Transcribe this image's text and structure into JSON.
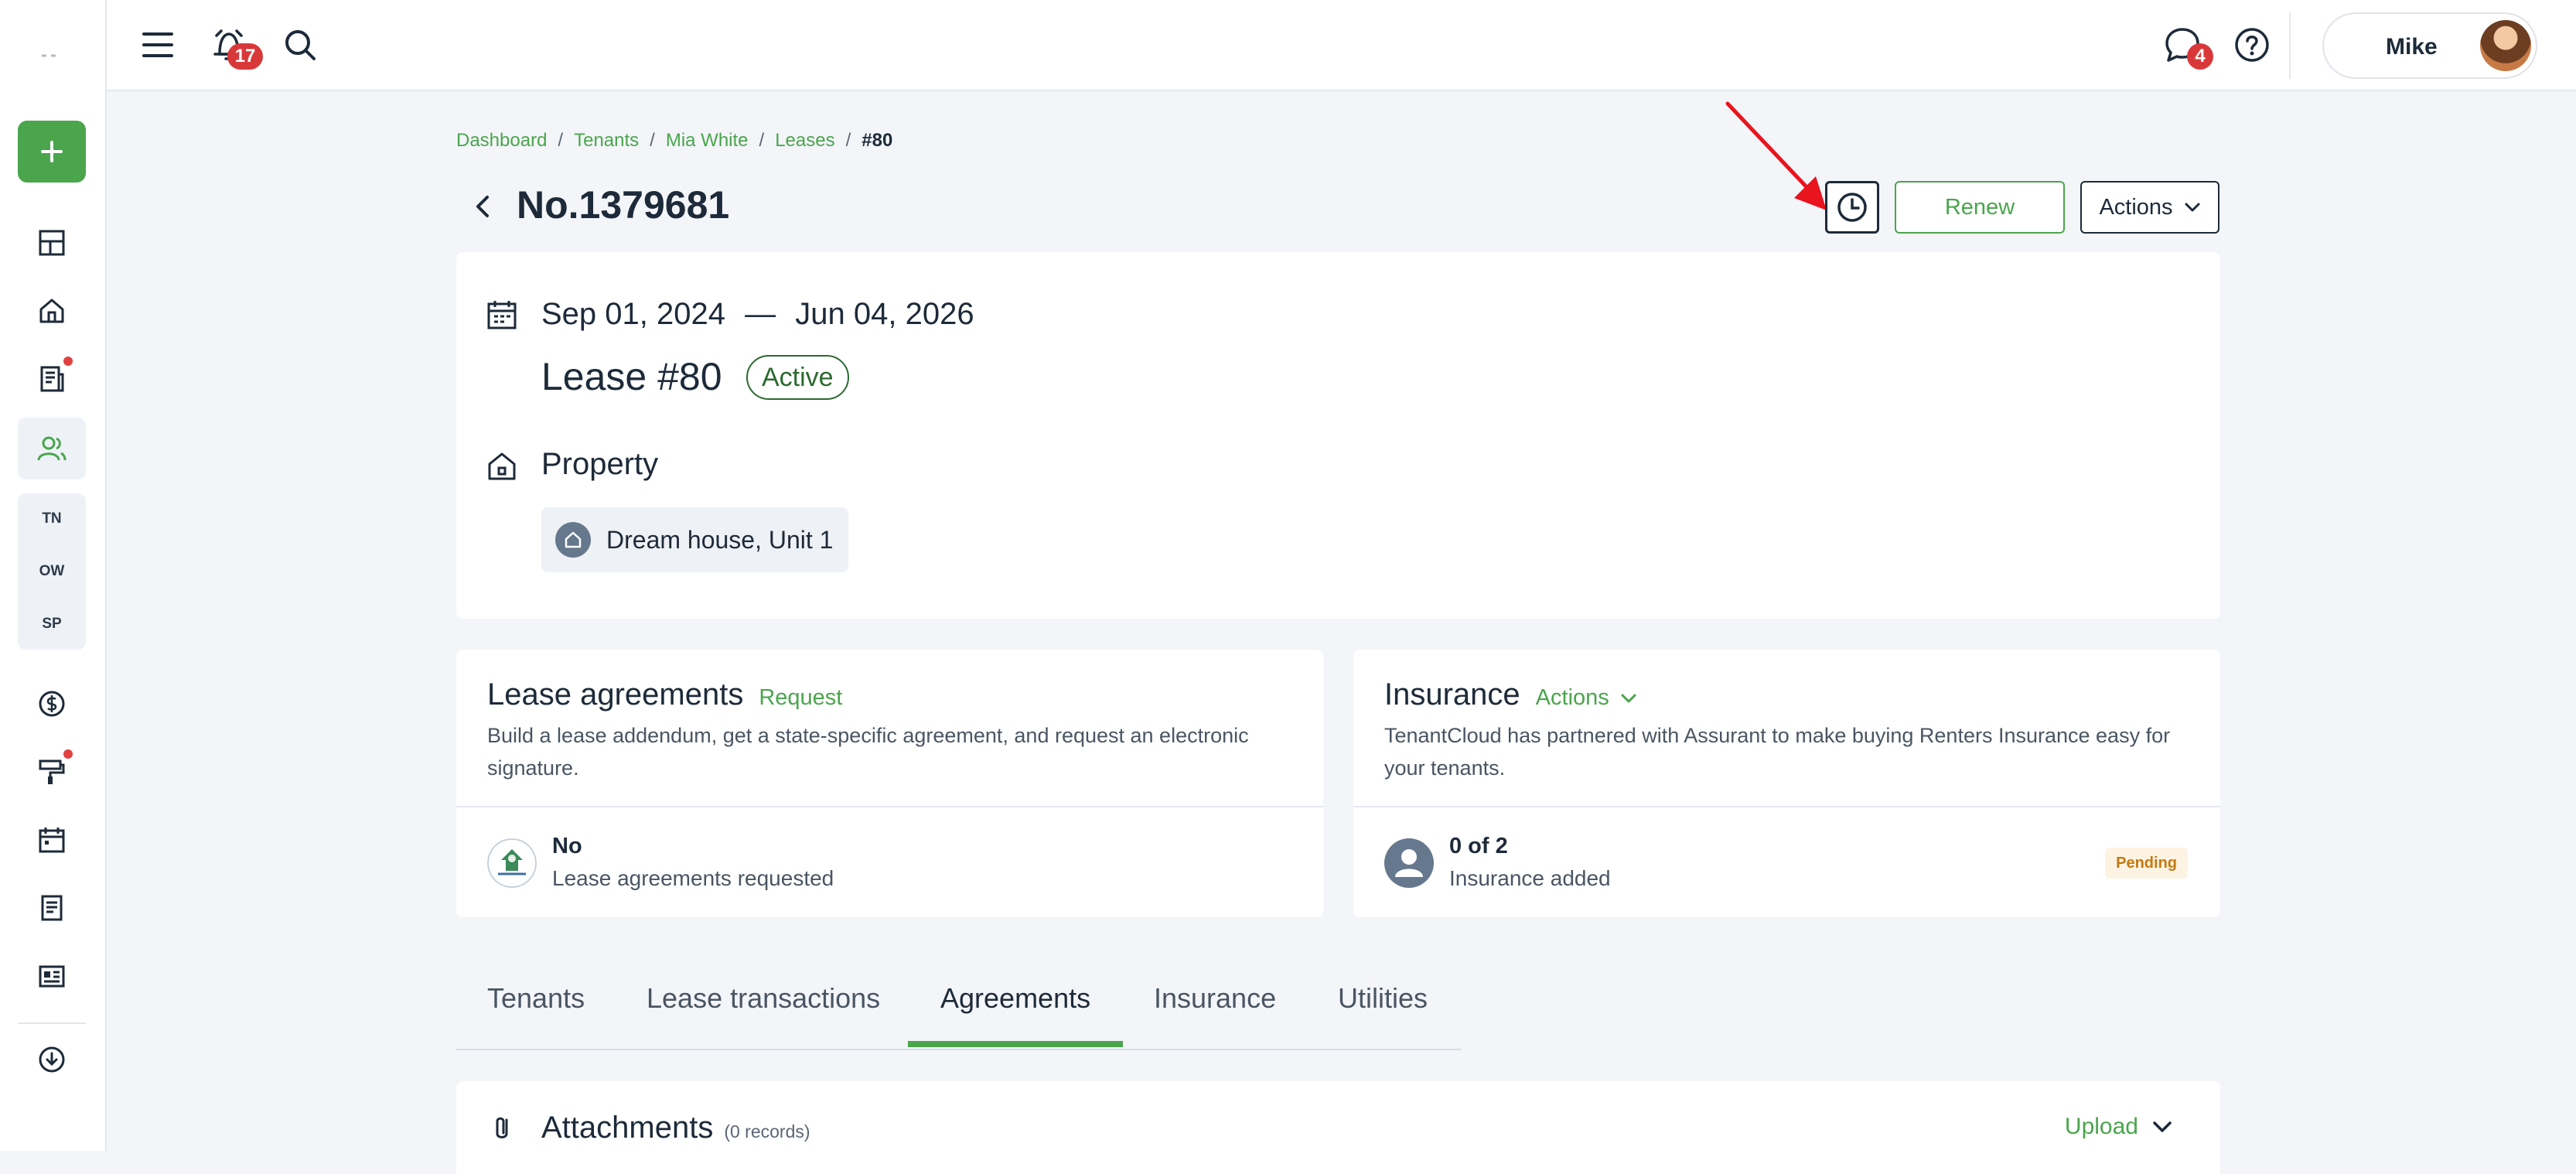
{
  "topbar": {
    "alerts_badge": "17",
    "messages_badge": "4",
    "user_name": "Mike"
  },
  "sidebar": {
    "sub_items": [
      "TN",
      "OW",
      "SP"
    ]
  },
  "breadcrumb": {
    "items": [
      "Dashboard",
      "Tenants",
      "Mia White",
      "Leases"
    ],
    "current": "#80"
  },
  "header": {
    "title": "No.1379681",
    "renew_label": "Renew",
    "actions_label": "Actions"
  },
  "lease": {
    "start_date": "Sep 01, 2024",
    "date_separator": "—",
    "end_date": "Jun 04, 2026",
    "title": "Lease #80",
    "status": "Active",
    "property_label": "Property",
    "property_name": "Dream house, Unit 1"
  },
  "agreements": {
    "title": "Lease agreements",
    "link": "Request",
    "description": "Build a lease addendum, get a state-specific agreement, and request an electronic signature.",
    "foot_main": "No",
    "foot_sub": "Lease agreements requested"
  },
  "insurance": {
    "title": "Insurance",
    "link": "Actions",
    "description": "TenantCloud has partnered with Assurant to make buying Renters Insurance easy for your tenants.",
    "foot_main": "0 of 2",
    "foot_sub": "Insurance added",
    "status": "Pending"
  },
  "tabs": {
    "items": [
      "Tenants",
      "Lease transactions",
      "Agreements",
      "Insurance",
      "Utilities"
    ],
    "active": "Agreements"
  },
  "attachments": {
    "title": "Attachments",
    "count": "(0 records)",
    "upload_label": "Upload"
  },
  "colors": {
    "brand_green": "#4aa54c",
    "badge_red": "#d9383a",
    "text_dark": "#1d2a39",
    "pending_orange": "#c37a10"
  }
}
